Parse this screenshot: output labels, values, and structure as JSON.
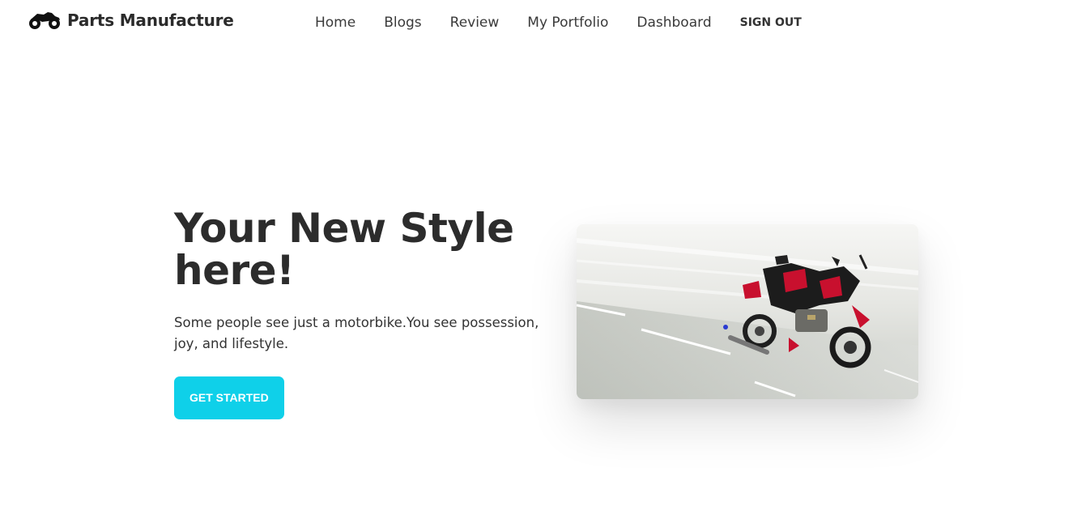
{
  "brand": {
    "name": "Parts Manufacture",
    "icon": "motorcycle-icon"
  },
  "nav": {
    "links": [
      "Home",
      "Blogs",
      "Review",
      "My Portfolio",
      "Dashboard"
    ],
    "signout": "SIGN OUT"
  },
  "hero": {
    "title": "Your New Style here!",
    "subtitle": "Some people see just a motorbike.You see possession, joy, and lifestyle.",
    "cta": "GET STARTED",
    "image": "exploded-motorbike-parts-image"
  },
  "colors": {
    "accent": "#0fd0e9",
    "text": "#333333"
  }
}
